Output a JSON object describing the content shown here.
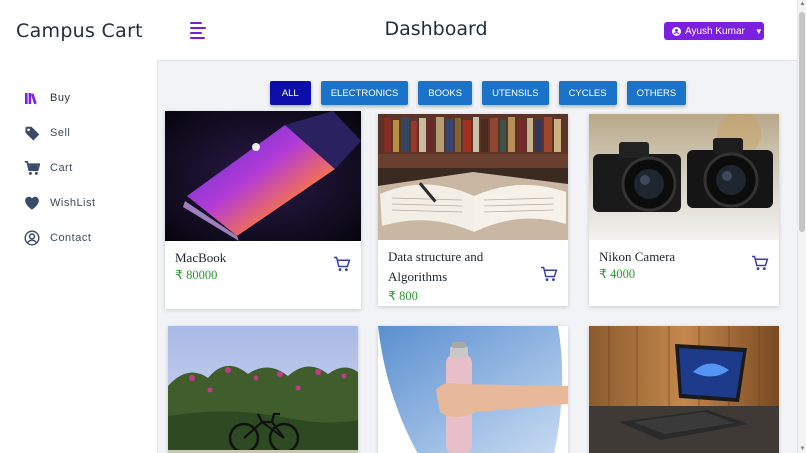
{
  "app": {
    "brand": "Campus Cart",
    "page_title": "Dashboard"
  },
  "user": {
    "name": "Ayush Kumar"
  },
  "sidebar": {
    "items": [
      {
        "label": "Buy",
        "icon": "books-icon",
        "active": true
      },
      {
        "label": "Sell",
        "icon": "tag-icon"
      },
      {
        "label": "Cart",
        "icon": "cart-icon"
      },
      {
        "label": "WishList",
        "icon": "heart-icon"
      },
      {
        "label": "Contact",
        "icon": "user-circle-icon"
      }
    ]
  },
  "filters": [
    "ALL",
    "ELECTRONICS",
    "BOOKS",
    "UTENSILS",
    "CYCLES",
    "OTHERS"
  ],
  "products": [
    {
      "name": "MacBook",
      "price": "₹ 80000"
    },
    {
      "name": "Data structure and Algorithms",
      "price": "₹ 800"
    },
    {
      "name": "Nikon Camera",
      "price": "₹ 4000"
    },
    {
      "name": "",
      "price": ""
    },
    {
      "name": "",
      "price": ""
    },
    {
      "name": "",
      "price": ""
    }
  ],
  "colors": {
    "accent": "#7b1fe0",
    "filter": "#1a73c9",
    "filter_active": "#0b0ea8",
    "price": "#2b9a30"
  }
}
